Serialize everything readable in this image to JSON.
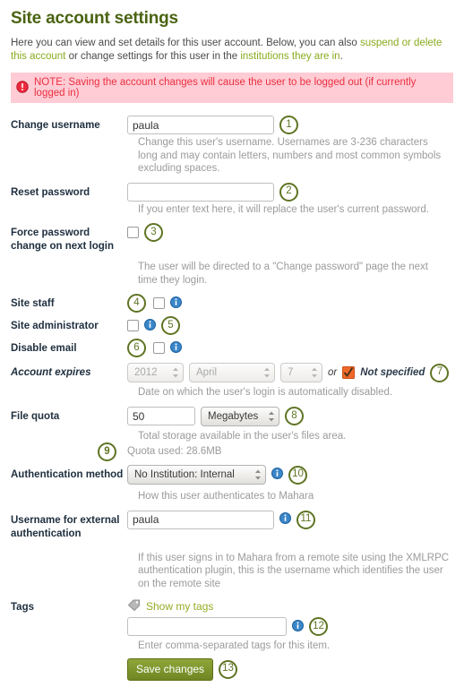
{
  "page": {
    "title": "Site account settings",
    "intro_part1": "Here you can view and set details for this user account. Below, you can also ",
    "intro_link1": "suspend or delete this account",
    "intro_part2": " or change settings for this user in the ",
    "intro_link2": "institutions they are in",
    "intro_part3": "."
  },
  "note": {
    "icon": "exclamation-circle-icon",
    "text": "NOTE: Saving the account changes will cause the user to be logged out (if currently logged in)"
  },
  "fields": {
    "change_username": {
      "label": "Change username",
      "value": "paula",
      "placeholder": "",
      "help": "Change this user's username. Usernames are 3-236 characters long and may contain letters, numbers and most common symbols excluding spaces.",
      "callout": "1"
    },
    "reset_password": {
      "label": "Reset password",
      "value": "",
      "placeholder": "",
      "help": "If you enter text here, it will replace the user's current password.",
      "callout": "2"
    },
    "force_password_change": {
      "label": "Force password change on next login",
      "checked": false,
      "help": "The user will be directed to a \"Change password\" page the next time they login.",
      "callout": "3"
    },
    "site_staff": {
      "label": "Site staff",
      "checked": false,
      "callout": "4",
      "info": "info-icon"
    },
    "site_administrator": {
      "label": "Site administrator",
      "checked": false,
      "callout": "5",
      "info": "info-icon"
    },
    "disable_email": {
      "label": "Disable email",
      "checked": false,
      "callout": "6",
      "info": "info-icon"
    },
    "account_expires": {
      "label": "Account expires",
      "year": "2012",
      "month": "April",
      "day": "7",
      "or_text": "or",
      "not_specified_label": "Not specified",
      "not_specified_checked": true,
      "help": "Date on which the user's login is automatically disabled.",
      "callout": "7"
    },
    "file_quota": {
      "label": "File quota",
      "value": "50",
      "unit": "Megabytes",
      "help": "Total storage available in the user's files area.",
      "quota_used": "Quota used: 28.6MB",
      "callout": "8",
      "callout_quota": "9"
    },
    "authentication_method": {
      "label": "Authentication method",
      "value": "No Institution: Internal",
      "help": "How this user authenticates to Mahara",
      "callout": "10",
      "info": "info-icon"
    },
    "external_username": {
      "label": "Username for external authentication",
      "value": "paula",
      "help": "If this user signs in to Mahara from a remote site using the XMLRPC authentication plugin, this is the username which identifies the user on the remote site",
      "callout": "11",
      "info": "info-icon"
    },
    "tags": {
      "label": "Tags",
      "show_tags_link": "Show my tags",
      "tag_icon": "tag-icon",
      "value": "",
      "help": "Enter comma-separated tags for this item.",
      "callout": "12",
      "info": "info-icon"
    },
    "save": {
      "label": "Save changes",
      "callout": "13"
    }
  },
  "colors": {
    "heading_green": "#4a6312",
    "link_green": "#8aab1e",
    "note_bg": "#ffccd5",
    "note_text": "#ea2f3f",
    "callout_ring": "#5e7422",
    "info_blue": "#2f74b5",
    "checkbox_orange": "#ef6a20"
  }
}
